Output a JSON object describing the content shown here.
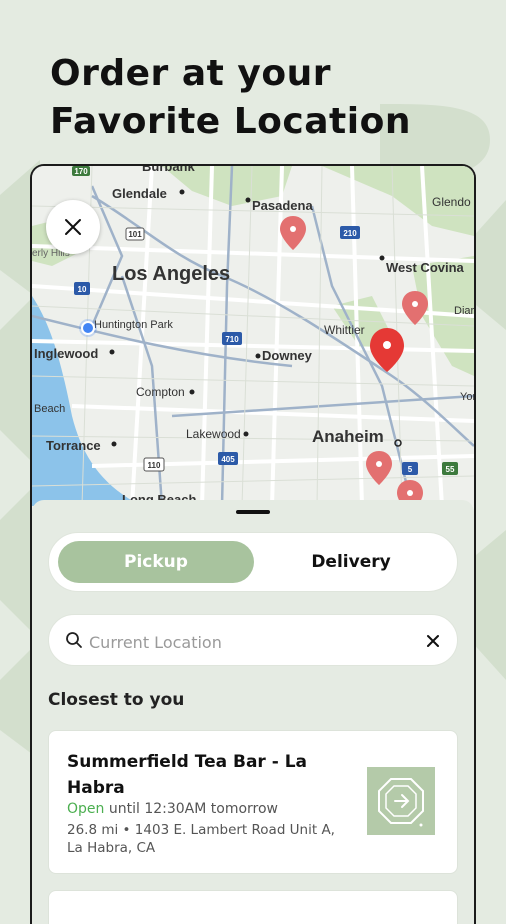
{
  "headline": {
    "line1": "Order at your",
    "line2": "Favorite Location"
  },
  "map": {
    "labels": {
      "burbank": "Burbank",
      "glendale": "Glendale",
      "pasadena": "Pasadena",
      "glendora": "Glendo",
      "los_angeles": "Los Angeles",
      "west_covina": "West Covina",
      "beverly_hills": "erly Hills",
      "huntington_park": "Huntington Park",
      "whittier": "Whittier",
      "inglewood": "Inglewood",
      "downey": "Downey",
      "diamond": "Diar",
      "compton": "Compton",
      "beach": "Beach",
      "torrance": "Torrance",
      "lakewood": "Lakewood",
      "anaheim": "Anaheim",
      "yorba": "Yor",
      "long_beach": "Long Beach"
    },
    "shields": {
      "i5_top": "170",
      "r101": "101",
      "i10": "10",
      "r210": "210",
      "i710": "710",
      "i405": "405",
      "r110": "110",
      "i5": "5",
      "r55": "55"
    }
  },
  "sheet": {
    "tabs": {
      "pickup": "Pickup",
      "delivery": "Delivery"
    },
    "search": {
      "placeholder": "Current Location"
    },
    "section_title": "Closest to you",
    "stores": [
      {
        "name": "Summerfield Tea Bar - La Habra",
        "status": "Open",
        "hours": "until 12:30AM tomorrow",
        "address": "26.8 mi • 1403 E. Lambert Road Unit A, La Habra, CA"
      }
    ]
  },
  "colors": {
    "accent": "#a8c39e",
    "open": "#4caf50",
    "pin": "#e05252",
    "pin_active": "#e53935"
  }
}
